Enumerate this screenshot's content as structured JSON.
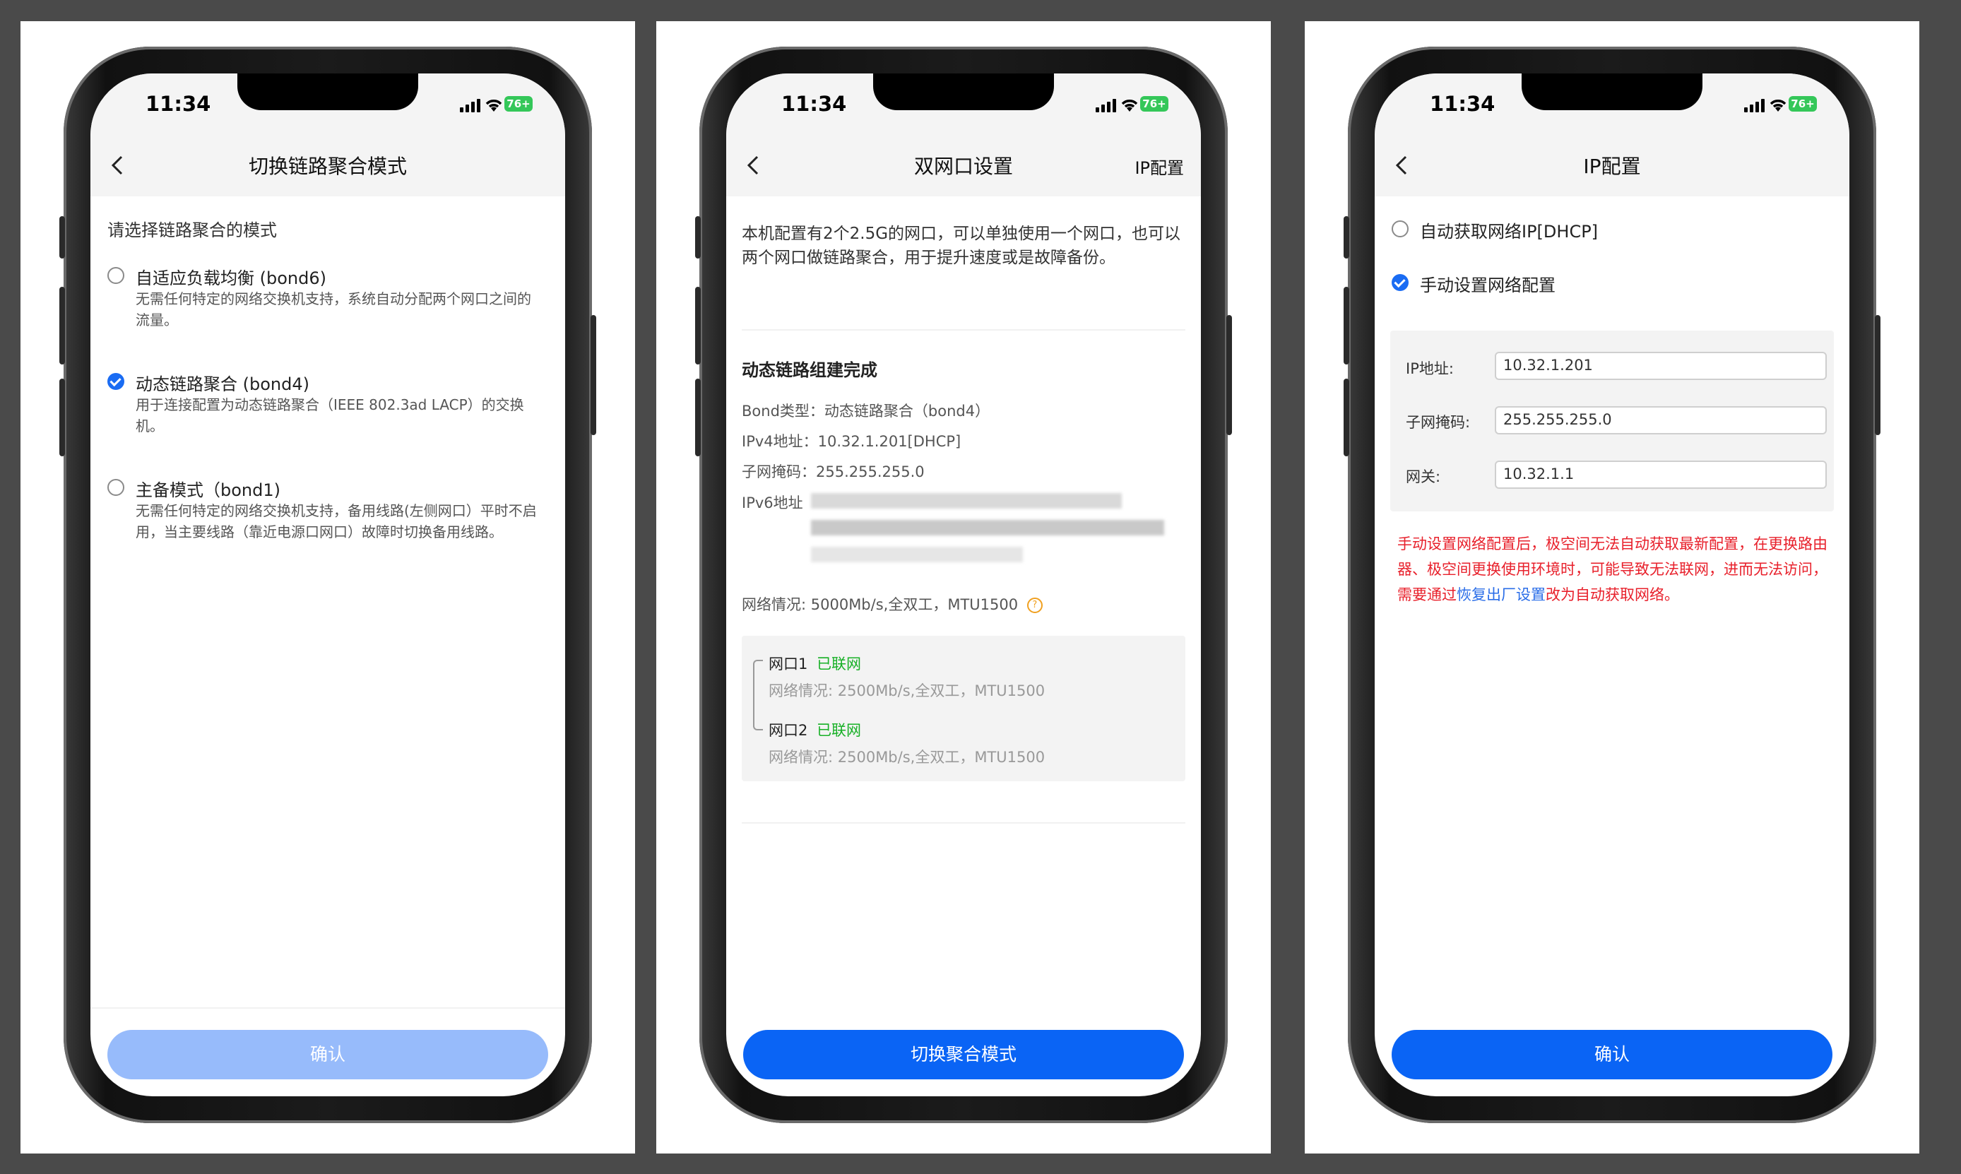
{
  "status": {
    "time": "11:34",
    "battery": "76+"
  },
  "screen1": {
    "title": "切换链路聚合模式",
    "prompt": "请选择链路聚合的模式",
    "options": [
      {
        "title": "自适应负载均衡 (bond6)",
        "desc": "无需任何特定的网络交换机支持，系统自动分配两个网口之间的流量。",
        "selected": false
      },
      {
        "title": "动态链路聚合 (bond4)",
        "desc": "用于连接配置为动态链路聚合（IEEE 802.3ad LACP）的交换机。",
        "selected": true
      },
      {
        "title": "主备模式（bond1)",
        "desc": "无需任何特定的网络交换机支持，备用线路(左侧网口）平时不启用，当主要线路（靠近电源口网口）故障时切换备用线路。",
        "selected": false
      }
    ],
    "confirm": "确认"
  },
  "screen2": {
    "title": "双网口设置",
    "right_action": "IP配置",
    "intro": "本机配置有2个2.5G的网口，可以单独使用一个网口，也可以两个网口做链路聚合，用于提升速度或是故障备份。",
    "section_title": "动态链路组建完成",
    "bond_type": "Bond类型：动态链路聚合（bond4）",
    "ipv4": "IPv4地址：10.32.1.201[DHCP]",
    "mask": "子网掩码：255.255.255.0",
    "ipv6_label": "IPv6地址",
    "net_status": "网络情况: 5000Mb/s,全双工，MTU1500",
    "ports": [
      {
        "name": "网口1",
        "state": "已联网",
        "detail": "网络情况: 2500Mb/s,全双工，MTU1500"
      },
      {
        "name": "网口2",
        "state": "已联网",
        "detail": "网络情况: 2500Mb/s,全双工，MTU1500"
      }
    ],
    "button": "切换聚合模式"
  },
  "screen3": {
    "title": "IP配置",
    "options": [
      {
        "label": "自动获取网络IP[DHCP]",
        "selected": false
      },
      {
        "label": "手动设置网络配置",
        "selected": true
      }
    ],
    "fields": [
      {
        "label": "IP地址:",
        "value": "10.32.1.201"
      },
      {
        "label": "子网掩码:",
        "value": "255.255.255.0"
      },
      {
        "label": "网关:",
        "value": "10.32.1.1"
      }
    ],
    "warning": "手动设置网络配置后，极空间无法自动获取最新配置，在更换路由器、极空间更换使用环境时，可能导致无法联网，进而无法访问，需要通过恢复出厂设置改为自动获取网络。",
    "warning_link": "恢复出厂",
    "warning_tail1": "设置",
    "warning_tail2": "改为自动获取网络。",
    "confirm": "确认"
  },
  "colors": {
    "accent": "#0a64f5",
    "disabled": "#97bbfb",
    "success": "#17b026",
    "warning": "#e8202b"
  }
}
